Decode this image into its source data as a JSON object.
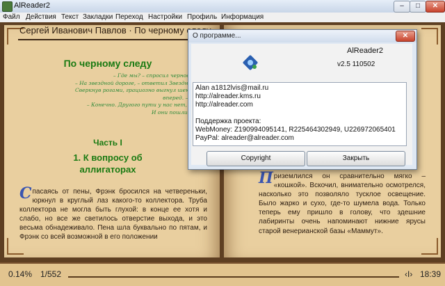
{
  "window": {
    "title": "AlReader2",
    "min": "–",
    "max": "□",
    "close": "✕"
  },
  "menu": [
    "Файл",
    "Действия",
    "Текст",
    "Закладки",
    "Переход",
    "Настройки",
    "Профиль",
    "Информация"
  ],
  "book": {
    "header": "Сергей Иванович Павлов · По черному следу",
    "title": "По черному следу",
    "epigraph": [
      "– Где мы? – спросил черноволосый.",
      "– На звездной дороге, – ответил Звездный путник.",
      "Сверкнув рогами, грациозно выгнул шею и посмотрел",
      "вперед. – Потом.",
      "– Конечно. Другого пути у нас нет, – сказал",
      "И они пошли дальше."
    ],
    "part": "Часть I",
    "chapter": [
      "1. К вопросу об",
      "аллигаторах"
    ],
    "left_dropcap": "С",
    "left_text": "пасаясь от пены, Фрэнк бросился на четвереньки, юркнул в круглый лаз какого-то коллектора. Труба коллектора не могла быть глухой: в конце ее хотя и слабо, но все же светилось отверстие выхода, и это весьма обнадеживало. Пена шла буквально по пятам, и Фрэнк со всей возможной в его положении",
    "right_dropcap": "П",
    "right_text": "риземлился он сравнительно мягко – «кошкой». Вскочил, внимательно осмотрелся, насколько это позволяло тусклое освещение. Было жарко и сухо, где-то шумела вода. Только теперь ему пришло в голову, что здешние лабиринты очень напоминают нижние ярусы старой венерианской базы «Маммут»."
  },
  "status": {
    "percent": "0.14%",
    "pages": "1/552",
    "nav": "‹I›",
    "time": "18:39"
  },
  "dialog": {
    "title": "О программе...",
    "close": "✕",
    "app_name": "AlReader2",
    "version": "v2.5 110502",
    "lines": [
      "Alan a1812lvis@mail.ru",
      "http://alreader.kms.ru",
      "http://alreader.com",
      "Поддержка проекта:",
      "WebMoney: Z190994095141, R225464302949, U226972065401",
      "PayPal: alreader@alreader.com"
    ],
    "copyright_label": "Copyright",
    "close_label": "Закрыть"
  }
}
